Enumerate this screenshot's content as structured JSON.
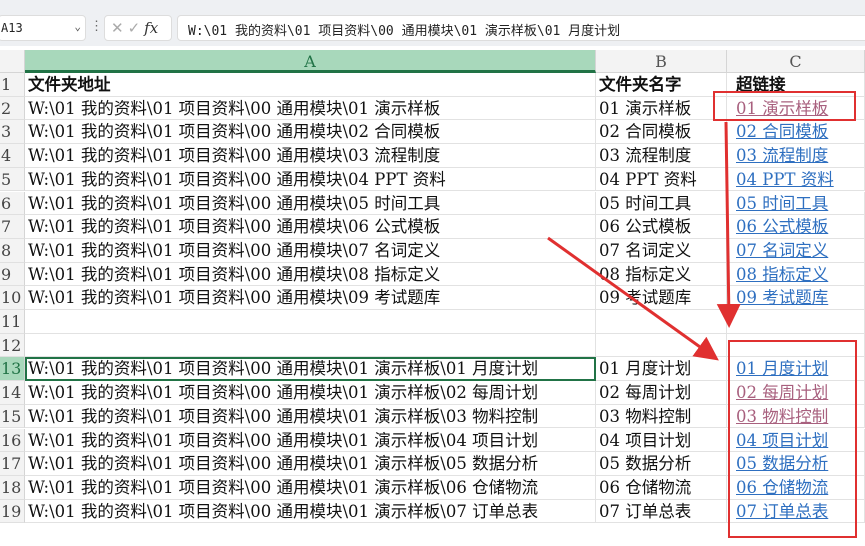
{
  "toolbar": {
    "name_box": "A13",
    "formula": "W:\\01 我的资料\\01 项目资料\\00 通用模块\\01 演示样板\\01 月度计划",
    "fx": "fx",
    "cancel": "✕",
    "confirm": "✓"
  },
  "columns": [
    "A",
    "B",
    "C"
  ],
  "header": {
    "num": "1",
    "a": "文件夹地址",
    "b": "文件夹名字",
    "c": "超链接"
  },
  "rows": [
    {
      "num": "2",
      "a": "W:\\01 我的资料\\01 项目资料\\00 通用模块\\01 演示样板",
      "b": "01 演示样板",
      "c": "01 演示样板",
      "visited": true
    },
    {
      "num": "3",
      "a": "W:\\01 我的资料\\01 项目资料\\00 通用模块\\02 合同模板",
      "b": "02 合同模板",
      "c": "02 合同模板"
    },
    {
      "num": "4",
      "a": "W:\\01 我的资料\\01 项目资料\\00 通用模块\\03 流程制度",
      "b": "03 流程制度",
      "c": "03 流程制度"
    },
    {
      "num": "5",
      "a": "W:\\01 我的资料\\01 项目资料\\00 通用模块\\04 PPT 资料",
      "b": "04 PPT 资料",
      "c": "04 PPT 资料"
    },
    {
      "num": "6",
      "a": "W:\\01 我的资料\\01 项目资料\\00 通用模块\\05 时间工具",
      "b": "05 时间工具",
      "c": "05 时间工具"
    },
    {
      "num": "7",
      "a": "W:\\01 我的资料\\01 项目资料\\00 通用模块\\06 公式模板",
      "b": "06 公式模板",
      "c": "06 公式模板"
    },
    {
      "num": "8",
      "a": "W:\\01 我的资料\\01 项目资料\\00 通用模块\\07 名词定义",
      "b": "07 名词定义",
      "c": "07 名词定义"
    },
    {
      "num": "9",
      "a": "W:\\01 我的资料\\01 项目资料\\00 通用模块\\08 指标定义",
      "b": "08 指标定义",
      "c": "08 指标定义"
    },
    {
      "num": "10",
      "a": "W:\\01 我的资料\\01 项目资料\\00 通用模块\\09 考试题库",
      "b": "09 考试题库",
      "c": "09 考试题库"
    },
    {
      "num": "11",
      "a": "",
      "b": "",
      "c": ""
    },
    {
      "num": "12",
      "a": "",
      "b": "",
      "c": ""
    },
    {
      "num": "13",
      "a": "W:\\01 我的资料\\01 项目资料\\00 通用模块\\01 演示样板\\01 月度计划",
      "b": "01 月度计划",
      "c": "01 月度计划",
      "active": true
    },
    {
      "num": "14",
      "a": "W:\\01 我的资料\\01 项目资料\\00 通用模块\\01 演示样板\\02 每周计划",
      "b": "02 每周计划",
      "c": "02 每周计划",
      "visited": true
    },
    {
      "num": "15",
      "a": "W:\\01 我的资料\\01 项目资料\\00 通用模块\\01 演示样板\\03 物料控制",
      "b": "03 物料控制",
      "c": "03 物料控制",
      "visited": true
    },
    {
      "num": "16",
      "a": "W:\\01 我的资料\\01 项目资料\\00 通用模块\\01 演示样板\\04 项目计划",
      "b": "04 项目计划",
      "c": "04 项目计划"
    },
    {
      "num": "17",
      "a": "W:\\01 我的资料\\01 项目资料\\00 通用模块\\01 演示样板\\05 数据分析",
      "b": "05 数据分析",
      "c": "05 数据分析"
    },
    {
      "num": "18",
      "a": "W:\\01 我的资料\\01 项目资料\\00 通用模块\\01 演示样板\\06 仓储物流",
      "b": "06 仓储物流",
      "c": "06 仓储物流"
    },
    {
      "num": "19",
      "a": "W:\\01 我的资料\\01 项目资料\\00 通用模块\\01 演示样板\\07 订单总表",
      "b": "07 订单总表",
      "c": "07 订单总表"
    }
  ],
  "colors": {
    "link": "#2e6fc0",
    "visited": "#a8607e",
    "annotation": "#e03030",
    "selection": "#217346"
  }
}
